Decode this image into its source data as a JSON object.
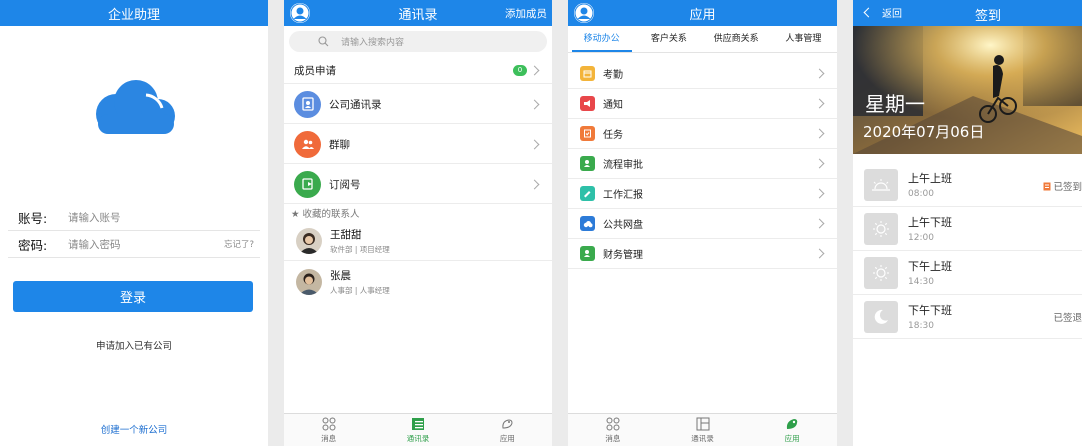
{
  "colors": {
    "primary": "#1e86e8",
    "green": "#2e9f4a",
    "bg": "#ebebeb"
  },
  "login": {
    "title": "企业助理",
    "account_label": "账号:",
    "account_placeholder": "请输入账号",
    "password_label": "密码:",
    "password_placeholder": "请输入密码",
    "forgot": "忘记了?",
    "login_button": "登录",
    "join_company": "申请加入已有公司",
    "create_company": "创建一个新公司"
  },
  "contacts": {
    "title": "通讯录",
    "add_member": "添加成员",
    "search_placeholder": "请输入搜索内容",
    "member_request": {
      "label": "成员申请",
      "badge": "0"
    },
    "groups": [
      {
        "label": "公司通讯录",
        "icon": "address-book-icon",
        "color": "#5b8de0"
      },
      {
        "label": "群聊",
        "icon": "group-chat-icon",
        "color": "#f06a3a"
      },
      {
        "label": "订阅号",
        "icon": "subscription-icon",
        "color": "#3aaa4d"
      }
    ],
    "favorites_label": "★ 收藏的联系人",
    "favorites": [
      {
        "name": "王甜甜",
        "sub": "软件部 | 项目经理"
      },
      {
        "name": "张晨",
        "sub": "人事部 | 人事经理"
      }
    ],
    "tabs": [
      {
        "label": "消息",
        "icon": "grid-icon"
      },
      {
        "label": "通讯录",
        "icon": "contacts-icon",
        "active": true
      },
      {
        "label": "应用",
        "icon": "apps-icon"
      }
    ]
  },
  "apps": {
    "title": "应用",
    "segments": [
      {
        "label": "移动办公",
        "active": true
      },
      {
        "label": "客户关系"
      },
      {
        "label": "供应商关系"
      },
      {
        "label": "人事管理"
      }
    ],
    "items": [
      {
        "label": "考勤",
        "icon": "attendance-icon",
        "color": "#f3b43a"
      },
      {
        "label": "通知",
        "icon": "megaphone-icon",
        "color": "#e8474a"
      },
      {
        "label": "任务",
        "icon": "task-icon",
        "color": "#f07a3a"
      },
      {
        "label": "流程审批",
        "icon": "approval-icon",
        "color": "#3aaa4d"
      },
      {
        "label": "工作汇报",
        "icon": "report-icon",
        "color": "#2ec0a8"
      },
      {
        "label": "公共网盘",
        "icon": "cloud-drive-icon",
        "color": "#2d7bd8"
      },
      {
        "label": "财务管理",
        "icon": "finance-icon",
        "color": "#3aaa4d"
      }
    ],
    "tabs": [
      {
        "label": "消息",
        "icon": "grid-icon"
      },
      {
        "label": "通讯录",
        "icon": "contacts-icon"
      },
      {
        "label": "应用",
        "icon": "apps-icon",
        "active": true
      }
    ]
  },
  "checkin": {
    "back": "返回",
    "title": "签到",
    "weekday": "星期一",
    "date": "2020年07月06日",
    "shifts": [
      {
        "name": "上午上班",
        "time": "08:00",
        "status": "已签到",
        "icon": "sunrise-icon"
      },
      {
        "name": "上午下班",
        "time": "12:00",
        "status": "",
        "icon": "sun-icon"
      },
      {
        "name": "下午上班",
        "time": "14:30",
        "status": "",
        "icon": "sun-icon"
      },
      {
        "name": "下午下班",
        "time": "18:30",
        "status": "已签退",
        "icon": "moon-icon"
      }
    ]
  }
}
